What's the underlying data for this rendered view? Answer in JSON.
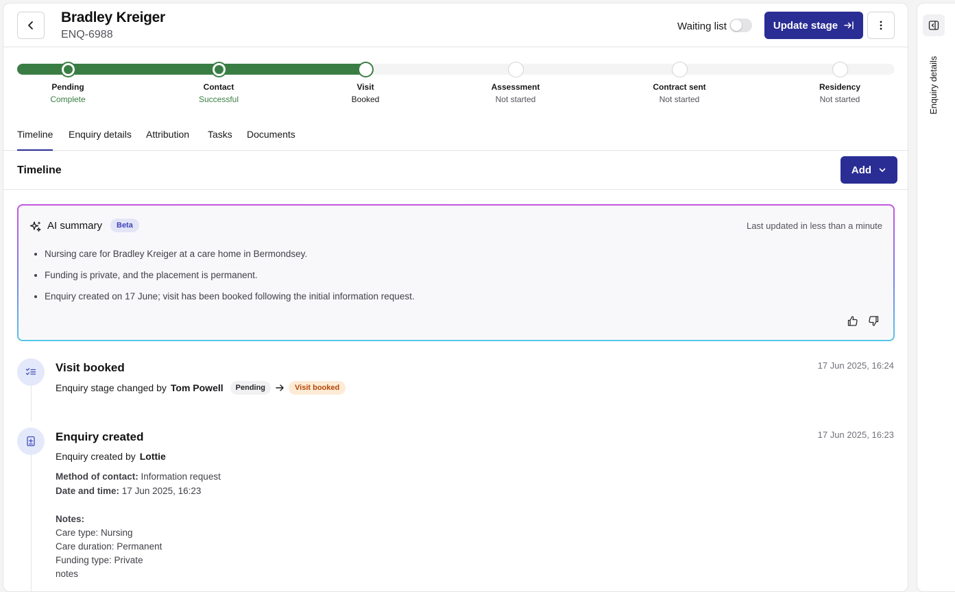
{
  "header": {
    "name": "Bradley Kreiger",
    "reference": "ENQ-6988",
    "waiting_list_label": "Waiting list",
    "waiting_list_on": false,
    "update_stage_label": "Update stage"
  },
  "stages": [
    {
      "label": "Pending",
      "status": "Complete",
      "state": "done"
    },
    {
      "label": "Contact",
      "status": "Successful",
      "state": "done"
    },
    {
      "label": "Visit",
      "status": "Booked",
      "state": "current"
    },
    {
      "label": "Assessment",
      "status": "Not started",
      "state": "todo"
    },
    {
      "label": "Contract sent",
      "status": "Not started",
      "state": "todo"
    },
    {
      "label": "Residency",
      "status": "Not started",
      "state": "todo"
    }
  ],
  "tabs": [
    "Timeline",
    "Enquiry details",
    "Attribution",
    "Tasks",
    "Documents"
  ],
  "active_tab": "Timeline",
  "timeline": {
    "title": "Timeline",
    "add_label": "Add"
  },
  "ai_summary": {
    "title": "AI summary",
    "badge": "Beta",
    "updated": "Last updated in less than a minute",
    "bullets": [
      "Nursing care for Bradley Kreiger at a care home in Bermondsey.",
      "Funding is private, and the placement is permanent.",
      "Enquiry created on 17 June; visit has been booked following the initial information request."
    ]
  },
  "events": [
    {
      "title": "Visit booked",
      "time": "17 Jun 2025, 16:24",
      "sub_prefix": "Enquiry stage changed by",
      "actor": "Tom Powell",
      "from_stage": "Pending",
      "to_stage": "Visit booked"
    },
    {
      "title": "Enquiry created",
      "time": "17 Jun 2025, 16:23",
      "sub_prefix": "Enquiry created by",
      "actor": "Lottie",
      "method_label": "Method of contact:",
      "method_value": "Information request",
      "date_label": "Date and time:",
      "date_value": "17 Jun 2025, 16:23",
      "notes_label": "Notes:",
      "notes_lines": [
        "Care type: Nursing",
        "Care duration: Permanent",
        "Funding type: Private",
        "notes"
      ]
    }
  ],
  "side_panel": {
    "label": "Enquiry details"
  },
  "colors": {
    "brand": "#2a2d94",
    "progress_green": "#3a7d44",
    "badge_orange": "#b54708"
  }
}
